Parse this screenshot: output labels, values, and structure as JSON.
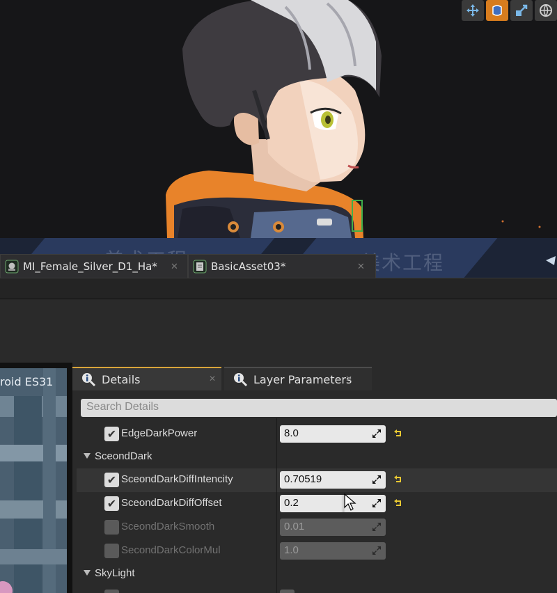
{
  "viewport": {
    "tools": [
      {
        "icon": "move-arrows-icon",
        "active": false
      },
      {
        "icon": "rotate-icon",
        "active": true
      },
      {
        "icon": "scale-icon",
        "active": false
      },
      {
        "icon": "globe-icon",
        "active": false
      }
    ]
  },
  "document_tabs": [
    {
      "label": "MI_Female_Silver_D1_Ha",
      "modified": "*",
      "icon": "material-instance-icon"
    },
    {
      "label": "BasicAsset03",
      "modified": "*",
      "icon": "asset-icon"
    }
  ],
  "watermarks": [
    "美术工程",
    "美术工程"
  ],
  "preview": {
    "label": "roid ES31"
  },
  "details_panel": {
    "tabs": [
      {
        "label": "Details",
        "active": true
      },
      {
        "label": "Layer Parameters",
        "active": false
      }
    ],
    "search_placeholder": "Search Details",
    "rows": {
      "edge_dark_power": {
        "name": "EdgeDarkPower",
        "checked": true,
        "value": "8.0"
      },
      "category_second_dark": {
        "label": "SceondDark"
      },
      "diff_intencity": {
        "name": "SceondDarkDiffIntencity",
        "checked": true,
        "value": "0.70519"
      },
      "diff_offset": {
        "name": "SceondDarkDiffOffset",
        "checked": true,
        "value": "0.2"
      },
      "smooth": {
        "name": "SceondDarkSmooth",
        "checked": false,
        "value": "0.01"
      },
      "color_mul": {
        "name": "SecondDarkColorMul",
        "checked": false,
        "value": "1.0"
      },
      "category_sky_light": {
        "label": "SkyLight"
      }
    }
  },
  "colors": {
    "accent_orange": "#d77c1e",
    "reset_yellow": "#e8c832",
    "tab_active": "#d8a53a"
  }
}
